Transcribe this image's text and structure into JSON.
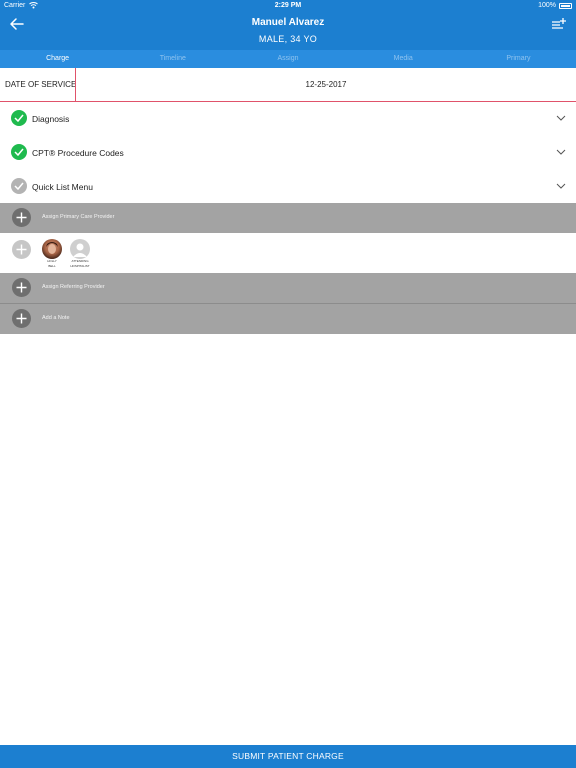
{
  "status_bar": {
    "carrier": "Carrier",
    "time": "2:29 PM",
    "battery": "100%"
  },
  "header": {
    "patient_name": "Manuel Alvarez",
    "patient_info": "MALE, 34 YO"
  },
  "tabs": [
    {
      "label": "Charge",
      "active": true
    },
    {
      "label": "Timeline",
      "active": false
    },
    {
      "label": "Assign",
      "active": false
    },
    {
      "label": "Media",
      "active": false
    },
    {
      "label": "Primary",
      "active": false
    }
  ],
  "date_of_service": {
    "label": "DATE OF SERVICE",
    "value": "12-25-2017"
  },
  "sections": [
    {
      "label": "Diagnosis",
      "status": "complete"
    },
    {
      "label": "CPT® Procedure Codes",
      "status": "complete"
    },
    {
      "label": "Quick List Menu",
      "status": "incomplete"
    }
  ],
  "assign_primary": {
    "label": "Assign Primary Care Provider"
  },
  "providers": [
    {
      "name_line1": "HOLLY",
      "name_line2": "BELL"
    },
    {
      "name_line1": "ATTENDING",
      "name_line2": "HOSPITALIST"
    }
  ],
  "assign_referring": {
    "label": "Assign Referring Provider"
  },
  "add_note": {
    "label": "Add a Note"
  },
  "submit": {
    "label": "SUBMIT PATIENT CHARGE"
  },
  "colors": {
    "primary": "#1c7fd0",
    "success": "#1fba4e",
    "accent_line": "#e0526a",
    "gray_row": "#a3a3a3"
  }
}
